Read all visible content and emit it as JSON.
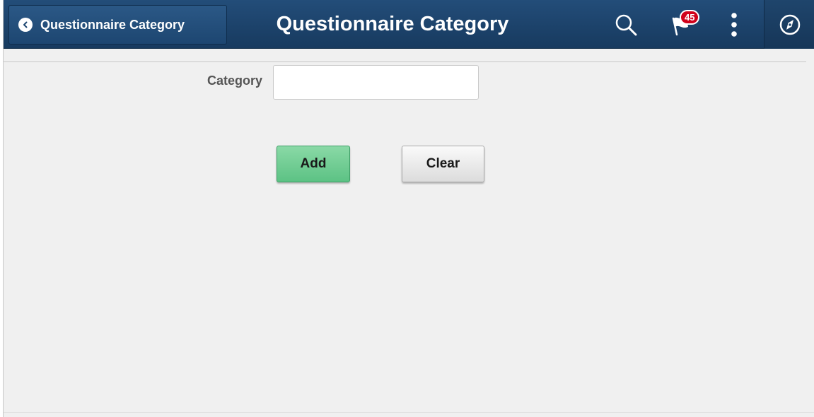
{
  "header": {
    "back_label": "Questionnaire Category",
    "title": "Questionnaire Category",
    "notifications_count": "45",
    "icons": [
      "chevron-left-icon",
      "search-icon",
      "flag-icon",
      "more-vertical-icon",
      "navbar-compass-icon"
    ]
  },
  "form": {
    "category_label": "Category",
    "category_value": "",
    "category_placeholder": ""
  },
  "actions": {
    "add_label": "Add",
    "clear_label": "Clear"
  },
  "colors": {
    "banner": "#1d4671",
    "add_button": "#6fcf95",
    "badge": "#d0021b",
    "background": "#f0f0f0"
  }
}
